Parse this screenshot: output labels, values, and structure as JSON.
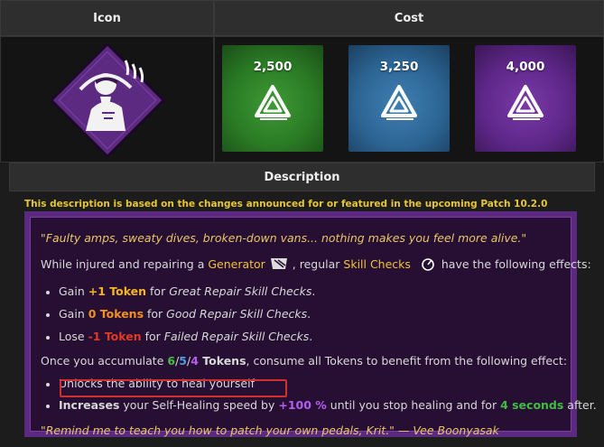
{
  "headers": {
    "icon": "Icon",
    "cost": "Cost",
    "description": "Description"
  },
  "costs": [
    {
      "value": "2,500",
      "color": "#2f8a2a"
    },
    {
      "value": "3,250",
      "color": "#2f6c9e"
    },
    {
      "value": "4,000",
      "color": "#63298f"
    }
  ],
  "notice": "This description is based on the changes announced for or featured in the upcoming Patch 10.2.0",
  "desc": {
    "quote1": "\"Faulty amps, sweaty dives, broken-down vans... nothing makes you feel more alive.\"",
    "line2": {
      "a": "While injured and repairing a ",
      "generator": "Generator",
      "b": " , regular ",
      "skill_checks": "Skill Checks",
      "c": " have the following effects:"
    },
    "b1": {
      "a": "Gain ",
      "tok": "+1 Token",
      "b": " for ",
      "c": "Great Repair Skill Checks",
      "d": "."
    },
    "b2": {
      "a": "Gain ",
      "tok": "0 Tokens",
      "b": " for ",
      "c": "Good Repair Skill Checks",
      "d": "."
    },
    "b3": {
      "a": "Lose ",
      "tok": "-1 Token",
      "b": " for ",
      "c": "Failed Repair Skill Checks",
      "d": "."
    },
    "accum": {
      "a": "Once you accumulate ",
      "n1": "6",
      "s1": "/",
      "n2": "5",
      "s2": "/",
      "n3": "4",
      "tokens": " Tokens",
      "b": ", consume all Tokens to benefit from the following effect:"
    },
    "e1": "Unlocks the ability to heal yourself",
    "e2": {
      "a": "Increases",
      "b": " your Self-Healing speed by ",
      "pct": "+100 %",
      "c": " until you stop healing and for ",
      "sec": "4 seconds",
      "d": " after."
    },
    "quote2": "\"Remind me to teach you how to patch your own pedals, Krit.\" — Vee Boonyasak"
  }
}
